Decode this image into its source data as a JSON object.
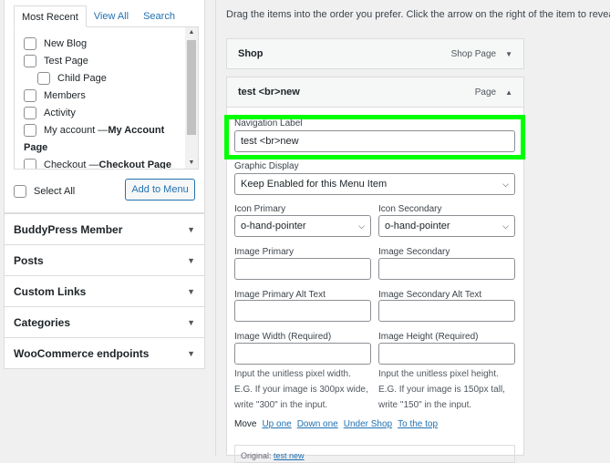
{
  "left": {
    "tabs": [
      "Most Recent",
      "View All",
      "Search"
    ],
    "pages": [
      {
        "label": "New Blog"
      },
      {
        "label": "Test Page"
      },
      {
        "label": "Child Page",
        "child": true
      },
      {
        "label": "Members"
      },
      {
        "label": "Activity"
      },
      {
        "label": "My account — ",
        "bold": "My Account"
      }
    ],
    "group_label": "Page",
    "pages_after": [
      {
        "label": "Checkout — ",
        "bold": "Checkout Page"
      }
    ],
    "select_all": "Select All",
    "add_button": "Add to Menu",
    "accordion": [
      "BuddyPress Member",
      "Posts",
      "Custom Links",
      "Categories",
      "WooCommerce endpoints"
    ]
  },
  "right": {
    "instructions": "Drag the items into the order you prefer. Click the arrow on the right of the item to reveal add",
    "item1": {
      "title": "Shop",
      "type": "Shop Page"
    },
    "item2": {
      "title": "test <br>new",
      "type": "Page"
    },
    "nav_label_label": "Navigation Label",
    "nav_label_value": "test <br>new",
    "graphic_display_label": "Graphic Display",
    "graphic_display_value": "Keep Enabled for this Menu Item",
    "icon_primary_label": "Icon Primary",
    "icon_primary_value": "o-hand-pointer",
    "icon_secondary_label": "Icon Secondary",
    "icon_secondary_value": "o-hand-pointer",
    "image_primary_label": "Image Primary",
    "image_secondary_label": "Image Secondary",
    "image_primary_alt_label": "Image Primary Alt Text",
    "image_secondary_alt_label": "Image Secondary Alt Text",
    "image_width_label": "Image Width (Required)",
    "image_height_label": "Image Height (Required)",
    "width_help": [
      "Input the unitless pixel width.",
      "E.G. If your image is 300px wide,",
      "write \"300\" in the input."
    ],
    "height_help": [
      "Input the unitless pixel height.",
      "E.G. If your image is 150px tall,",
      "write \"150\" in the input."
    ],
    "move_label": "Move",
    "move_links": [
      "Up one",
      "Down one",
      "Under Shop",
      "To the top"
    ],
    "original_label": "Original:",
    "original_link": "test new"
  }
}
